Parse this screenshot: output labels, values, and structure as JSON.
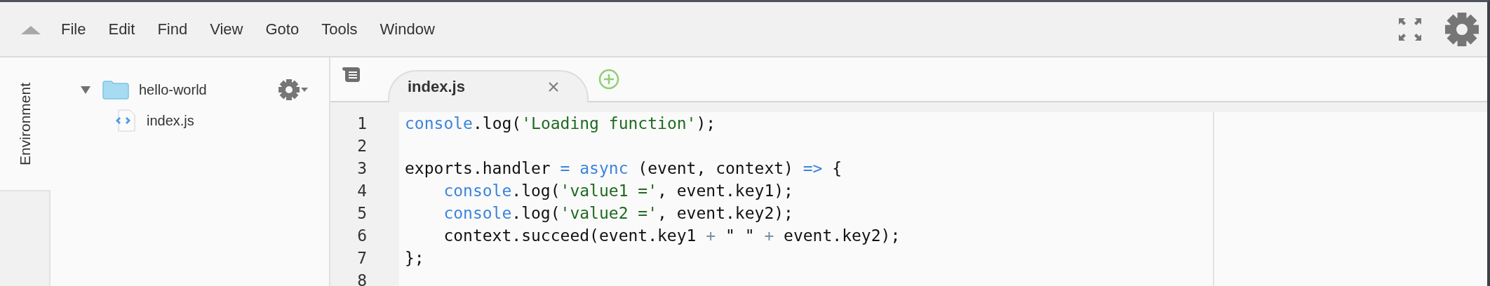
{
  "menu_bar": {
    "items": [
      "File",
      "Edit",
      "Find",
      "View",
      "Goto",
      "Tools",
      "Window"
    ]
  },
  "side_tabs": [
    {
      "label": "Environment",
      "selected": true
    }
  ],
  "file_tree": {
    "items": [
      {
        "name": "hello-world",
        "kind": "folder",
        "expanded": true,
        "children": [
          {
            "name": "index.js",
            "kind": "file"
          }
        ]
      }
    ]
  },
  "editor": {
    "tabs": [
      {
        "label": "index.js",
        "selected": true
      }
    ],
    "lines": [
      {
        "number": "1",
        "tokens": [
          {
            "text": "console",
            "kind": "builtin"
          },
          {
            "text": ".log(",
            "kind": "plain"
          },
          {
            "text": "'Loading function'",
            "kind": "string"
          },
          {
            "text": ");",
            "kind": "plain"
          }
        ]
      },
      {
        "number": "2"
      },
      {
        "number": "3",
        "tokens": [
          {
            "text": "exports.handler ",
            "kind": "plain"
          },
          {
            "text": "=",
            "kind": "operator"
          },
          {
            "text": " async",
            "kind": "keyword"
          },
          {
            "text": " (event, context) ",
            "kind": "plain"
          },
          {
            "text": "=>",
            "kind": "operator"
          },
          {
            "text": " {",
            "kind": "plain"
          }
        ]
      },
      {
        "number": "4",
        "tokens": [
          {
            "text": "    console",
            "kind": "builtin"
          },
          {
            "text": ".log(",
            "kind": "plain"
          },
          {
            "text": "'value1 ='",
            "kind": "string"
          },
          {
            "text": ", event.key1);",
            "kind": "plain"
          }
        ]
      },
      {
        "number": "5",
        "tokens": [
          {
            "text": "    console",
            "kind": "builtin"
          },
          {
            "text": ".log(",
            "kind": "plain"
          },
          {
            "text": "'value2 ='",
            "kind": "string"
          },
          {
            "text": ", event.key2);",
            "kind": "plain"
          }
        ]
      },
      {
        "number": "6",
        "tokens": [
          {
            "text": "    context.succeed(event.key1 ",
            "kind": "plain"
          },
          {
            "text": "+",
            "kind": "arith"
          },
          {
            "text": " \" \" ",
            "kind": "plain"
          },
          {
            "text": "+",
            "kind": "arith"
          },
          {
            "text": " event.key2);",
            "kind": "plain"
          }
        ]
      },
      {
        "number": "7",
        "tokens": [
          {
            "text": "};",
            "kind": "plain"
          }
        ]
      },
      {
        "number": "8"
      }
    ]
  }
}
